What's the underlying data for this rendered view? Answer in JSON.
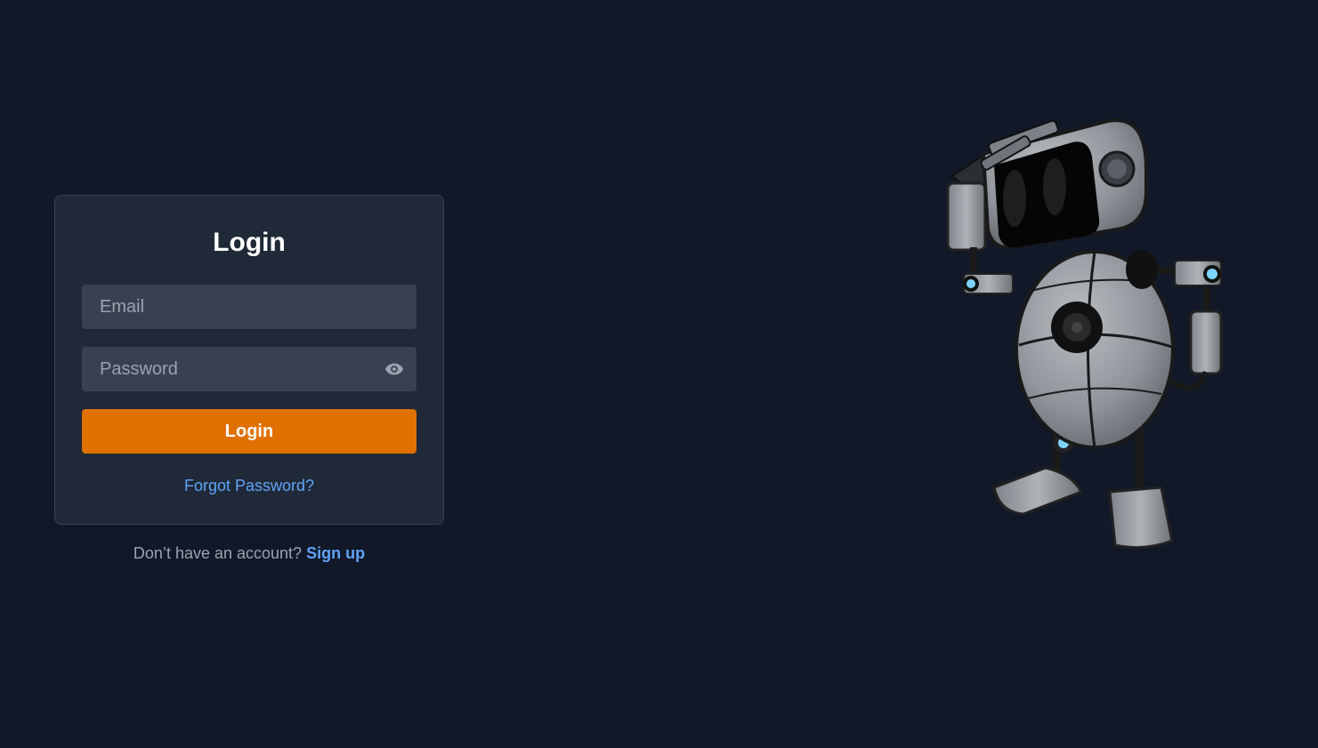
{
  "login_card": {
    "title": "Login",
    "email_placeholder": "Email",
    "password_placeholder": "Password",
    "password_toggle_icon": "eye-icon",
    "submit_label": "Login",
    "forgot_password_label": "Forgot Password?"
  },
  "signup": {
    "prompt": "Don’t have an account?",
    "link_label": "Sign up"
  },
  "illustration": {
    "icon": "robot-illustration"
  },
  "colors": {
    "background": "#111827",
    "card": "#1f2937",
    "input": "#374151",
    "accent": "#e07000",
    "link": "#60a5fa"
  }
}
